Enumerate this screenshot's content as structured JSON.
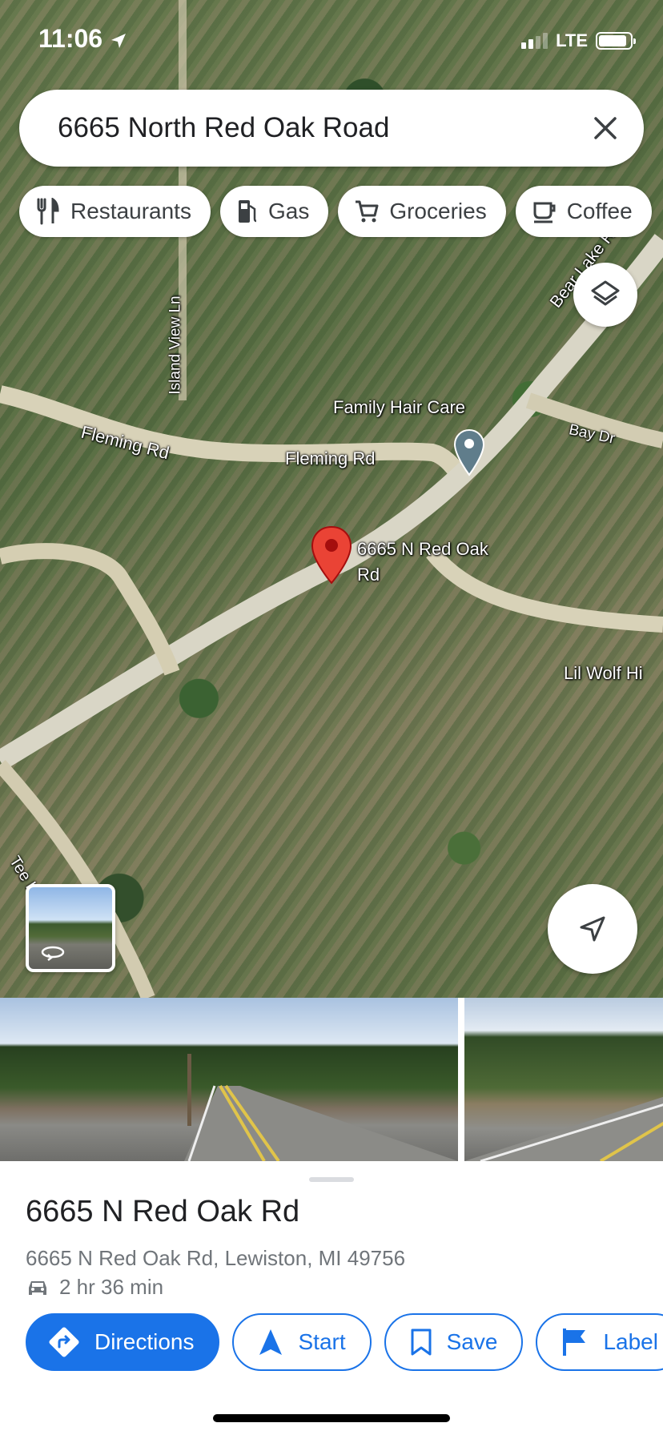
{
  "status_bar": {
    "time": "11:06",
    "network": "LTE"
  },
  "search": {
    "query": "6665 North Red Oak Road"
  },
  "chips": [
    {
      "label": "Restaurants",
      "icon": "fork-knife-icon"
    },
    {
      "label": "Gas",
      "icon": "gas-pump-icon"
    },
    {
      "label": "Groceries",
      "icon": "cart-icon"
    },
    {
      "label": "Coffee",
      "icon": "coffee-cup-icon"
    }
  ],
  "map": {
    "labels": {
      "island_view_ln": "Island View Ln",
      "fleming_rd_1": "Fleming Rd",
      "fleming_rd_2": "Fleming Rd",
      "family_hair_care": "Family Hair Care",
      "bay_dr": "Bay Dr",
      "bear_rd": "Bear Lake Rd",
      "lil_wolf": "Lil Wolf Hi",
      "tee_lake": "Tee Lake R",
      "pin_label_line1": "6665 N Red Oak",
      "pin_label_line2": "Rd"
    }
  },
  "place": {
    "title": "6665 N Red Oak Rd",
    "address": "6665 N Red Oak Rd, Lewiston, MI 49756",
    "drive_time": "2 hr 36 min"
  },
  "actions": {
    "directions": "Directions",
    "start": "Start",
    "save": "Save",
    "label": "Label"
  },
  "colors": {
    "accent": "#1a73e8",
    "pin_red": "#ea4335",
    "pin_grey": "#607d8b"
  }
}
